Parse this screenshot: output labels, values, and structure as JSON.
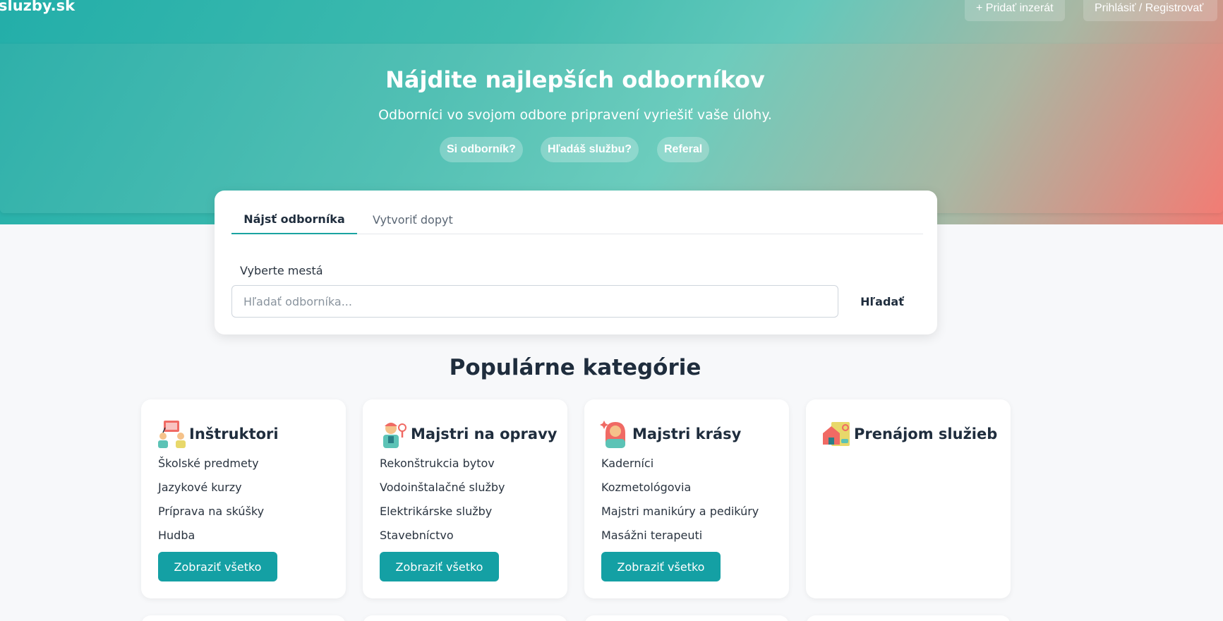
{
  "nav": {
    "logo": "sluzby.sk",
    "add_label": "+ Pridať inzerát",
    "login_label": "Prihlásiť / Registrovať"
  },
  "hero": {
    "title": "Nájdite najlepších odborníkov",
    "subtitle": "Odborníci vo svojom odbore pripravení vyriešiť vaše úlohy.",
    "pills": [
      "Si odborník?",
      "Hľadáš službu?",
      "Referal"
    ]
  },
  "search": {
    "tabs": [
      "Nájsť odborníka",
      "Vytvoriť dopyt"
    ],
    "active_tab": "Nájsť odborníka",
    "label": "Vyberte mestá",
    "placeholder": "Hľadať odborníka...",
    "value": "",
    "button": "Hľadať"
  },
  "categories": {
    "title": "Populárne kategórie",
    "items": [
      {
        "icon": "instructor-icon",
        "title": "Inštruktori",
        "links": [
          "Školské predmety",
          "Jazykové kurzy",
          "Príprava na skúšky",
          "Hudba"
        ],
        "button": "Zobraziť všetko"
      },
      {
        "icon": "repairman-icon",
        "title": "Majstri na opravy",
        "links": [
          "Rekonštrukcia bytov",
          "Vodoinštalačné služby",
          "Elektrikárske služby",
          "Stavebníctvo"
        ],
        "button": "Zobraziť všetko"
      },
      {
        "icon": "beauty-icon",
        "title": "Majstri krásy",
        "links": [
          "Kaderníci",
          "Kozmetológovia",
          "Majstri manikúry a pedikúry",
          "Masážni terapeuti"
        ],
        "button": "Zobraziť všetko"
      },
      {
        "icon": "rental-icon",
        "title": "Prenájom služieb",
        "links": [],
        "button": ""
      }
    ]
  },
  "colors": {
    "accent": "#14a0a4",
    "hero_start": "#2fb0aa",
    "hero_end": "#f27c74",
    "background": "#f7f8fa"
  }
}
